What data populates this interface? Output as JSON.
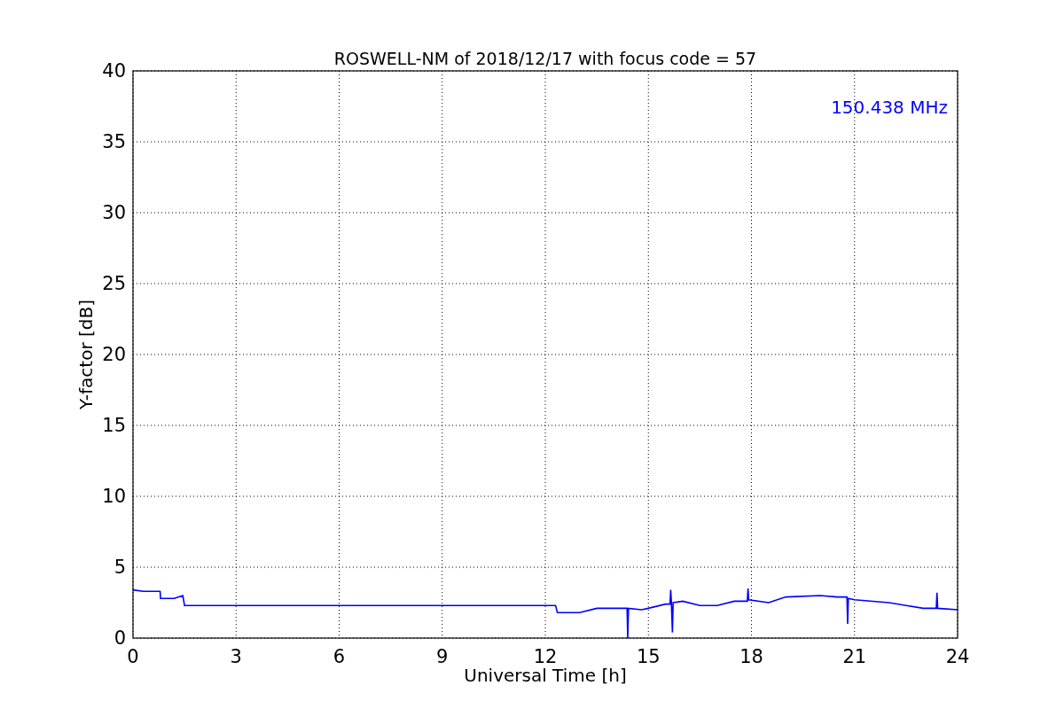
{
  "chart_data": {
    "type": "line",
    "title": "ROSWELL-NM of 2018/12/17 with focus code = 57",
    "xlabel": "Universal Time [h]",
    "ylabel": "Y-factor [dB]",
    "x": [
      0,
      0.3,
      0.6,
      0.79,
      0.8,
      1.2,
      1.45,
      1.5,
      12.3,
      12.35,
      13,
      13.5,
      14,
      14.38,
      14.4,
      14.42,
      14.8,
      15,
      15.5,
      15.63,
      15.65,
      15.67,
      15.7,
      15.72,
      16,
      16.5,
      17,
      17.5,
      17.88,
      17.9,
      17.92,
      18.5,
      19,
      20,
      20.5,
      20.78,
      20.8,
      20.82,
      21,
      22,
      23,
      23.38,
      23.4,
      23.42,
      24
    ],
    "grid": true,
    "series": [
      {
        "color": "#0000ff",
        "values": [
          3.4,
          3.3,
          3.3,
          3.3,
          2.8,
          2.8,
          3.0,
          2.3,
          2.3,
          1.8,
          1.8,
          2.1,
          2.1,
          2.1,
          0.0,
          2.1,
          2.0,
          2.1,
          2.4,
          2.4,
          3.4,
          2.5,
          0.4,
          2.5,
          2.6,
          2.3,
          2.3,
          2.6,
          2.6,
          3.5,
          2.7,
          2.5,
          2.9,
          3.0,
          2.9,
          2.9,
          1.0,
          2.8,
          2.7,
          2.5,
          2.1,
          2.1,
          3.2,
          2.1,
          2.0
        ]
      }
    ],
    "xlim": [
      0,
      24
    ],
    "ylim": [
      0,
      40
    ],
    "xticks": [
      0,
      3,
      6,
      9,
      12,
      15,
      18,
      21,
      24
    ],
    "yticks": [
      0,
      5,
      10,
      15,
      20,
      25,
      30,
      35,
      40
    ],
    "annotations": [
      {
        "text": "150.438 MHz"
      }
    ]
  }
}
